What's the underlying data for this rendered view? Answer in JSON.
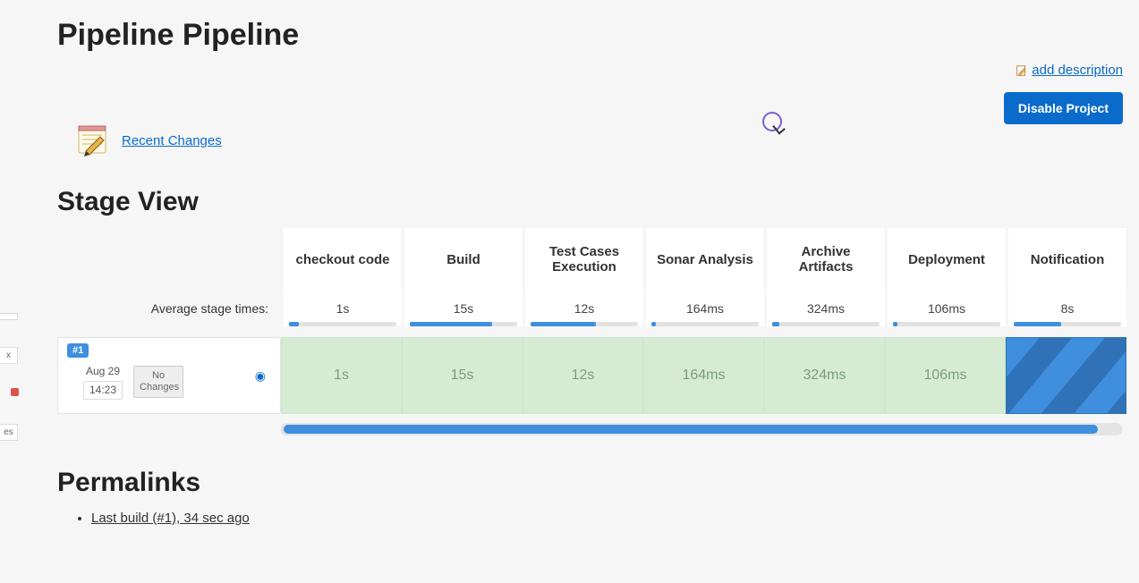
{
  "page": {
    "title": "Pipeline Pipeline",
    "add_description_label": "add description",
    "disable_label": "Disable Project",
    "recent_changes_label": "Recent Changes"
  },
  "stage_view": {
    "heading": "Stage View",
    "avg_label": "Average stage times:",
    "stages": [
      {
        "name": "checkout code",
        "avg": "1s",
        "bar_pct": 8
      },
      {
        "name": "Build",
        "avg": "15s",
        "bar_pct": 70
      },
      {
        "name": "Test Cases Execution",
        "avg": "12s",
        "bar_pct": 55
      },
      {
        "name": "Sonar Analysis",
        "avg": "164ms",
        "bar_pct": 4
      },
      {
        "name": "Archive Artifacts",
        "avg": "324ms",
        "bar_pct": 6
      },
      {
        "name": "Deployment",
        "avg": "106ms",
        "bar_pct": 4
      },
      {
        "name": "Notification",
        "avg": "8s",
        "bar_pct": 40
      }
    ],
    "run": {
      "badge": "#1",
      "date": "Aug 29",
      "time": "14:23",
      "no_changes": "No Changes",
      "cells": [
        {
          "value": "1s",
          "state": "ok"
        },
        {
          "value": "15s",
          "state": "ok"
        },
        {
          "value": "12s",
          "state": "ok"
        },
        {
          "value": "164ms",
          "state": "ok"
        },
        {
          "value": "324ms",
          "state": "ok"
        },
        {
          "value": "106ms",
          "state": "ok"
        },
        {
          "value": "",
          "state": "running"
        }
      ]
    }
  },
  "permalinks": {
    "heading": "Permalinks",
    "last_build": "Last build (#1), 34 sec ago"
  },
  "side_hints": {
    "a": "",
    "b": "x",
    "c": "es"
  }
}
